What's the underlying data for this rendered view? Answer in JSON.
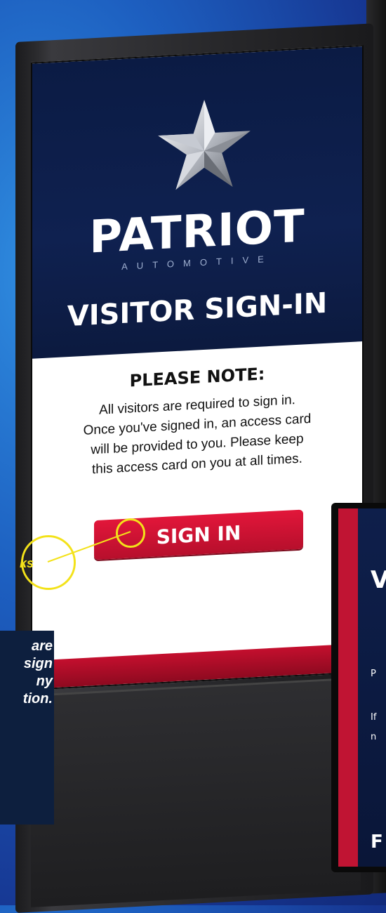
{
  "kiosk": {
    "brand": "PATRIOT",
    "brand_sub": "AUTOMOTIVE",
    "title": "VISITOR SIGN-IN",
    "note_heading": "PLEASE NOTE:",
    "note_lines": [
      "All visitors are required to sign in.",
      "Once you've signed in, an access card",
      "will be provided to you. Please keep",
      "this access card on you at all times."
    ],
    "sign_in_label": "SIGN IN"
  },
  "callout": {
    "label": "ks",
    "lines": [
      "are",
      "",
      "sign",
      "ny",
      "tion."
    ]
  },
  "preview": {
    "letter_v": "V",
    "letter_p": "P",
    "letter_i": "If",
    "letter_n": "n",
    "letter_logo": "F"
  },
  "colors": {
    "navy": "#0f2150",
    "red": "#c40f2e",
    "highlight": "#f3e21a"
  }
}
